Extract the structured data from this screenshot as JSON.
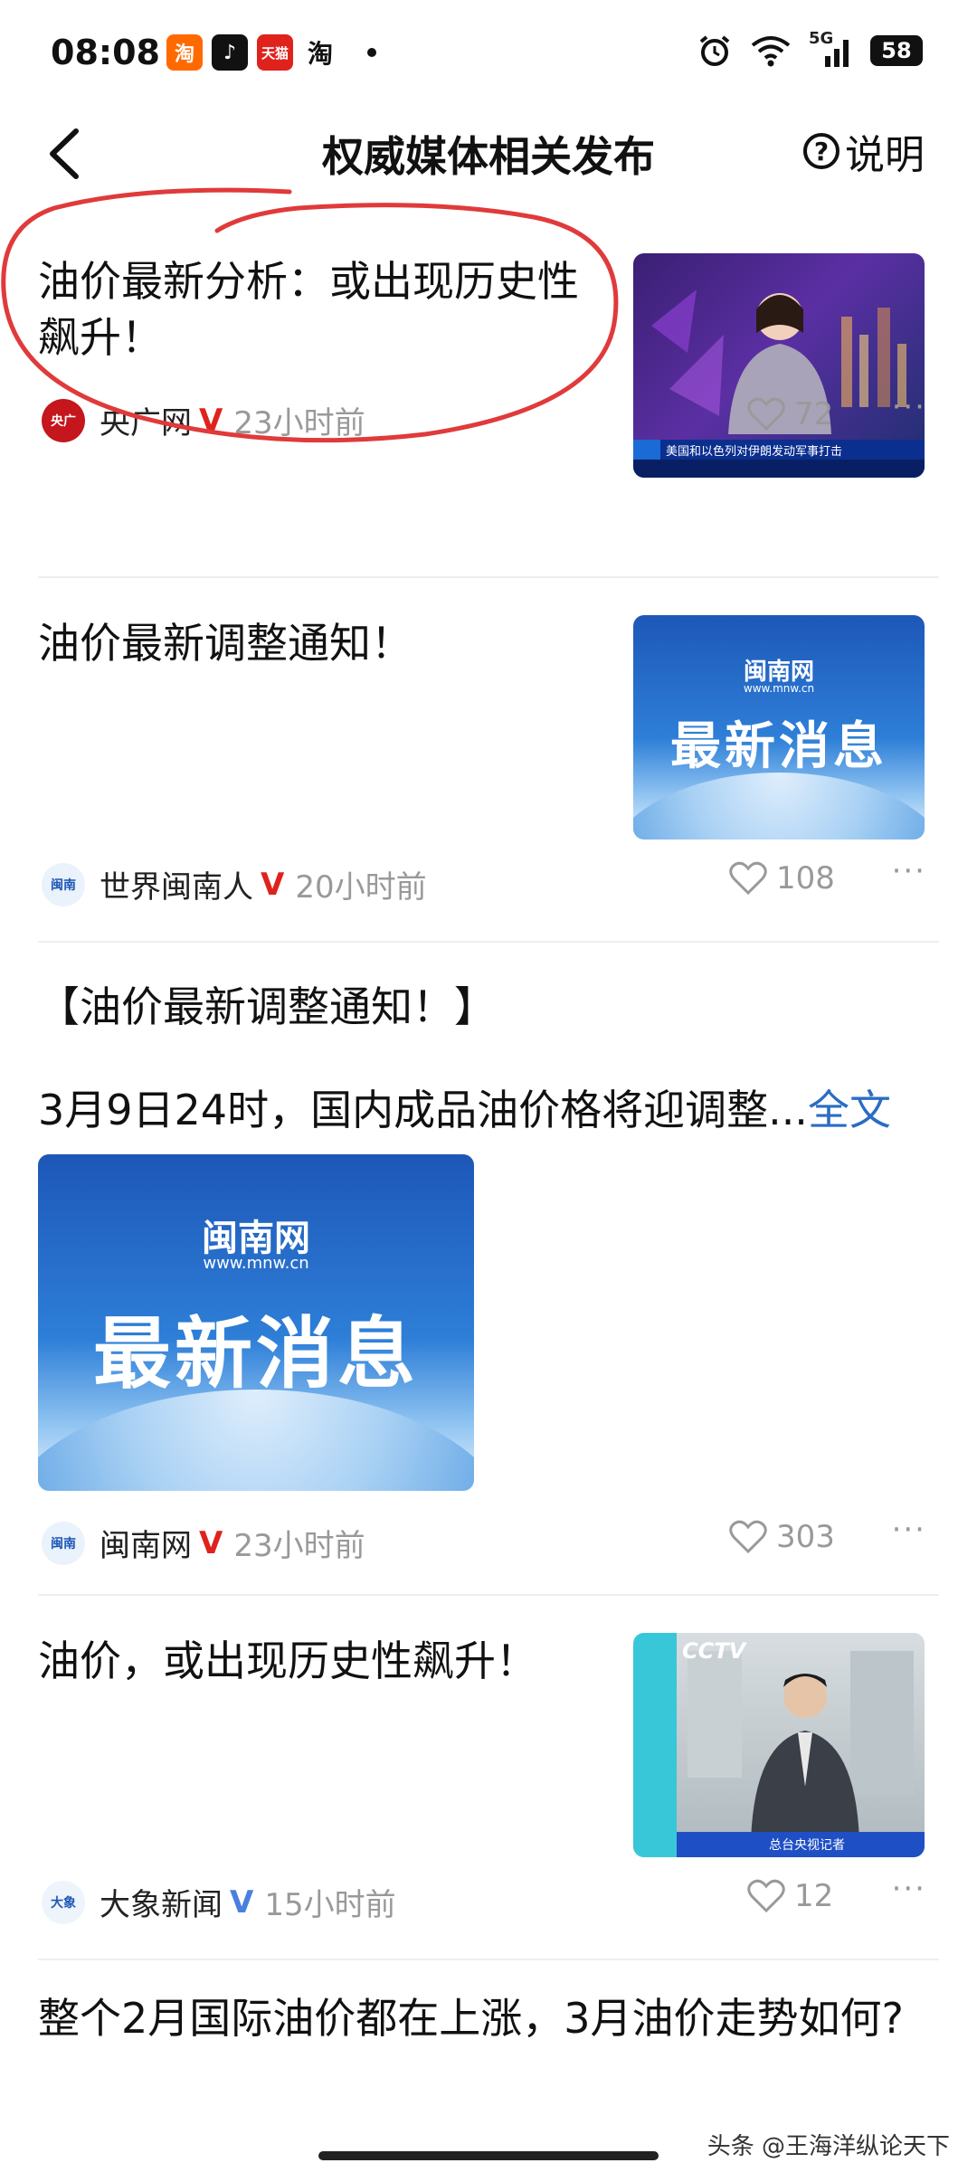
{
  "status_bar": {
    "time": "08:08",
    "apps": [
      {
        "name": "taobao-tejia-icon",
        "label": "淘",
        "color": "#ff6a00"
      },
      {
        "name": "douyin-icon",
        "label": "♪",
        "color": "#111111"
      },
      {
        "name": "tmall-icon",
        "label": "天猫",
        "color": "#e0221d"
      },
      {
        "name": "taobao-icon",
        "label": "淘",
        "color": "#ffffff"
      }
    ],
    "network": "5G",
    "battery": "58"
  },
  "nav": {
    "title": "权威媒体相关发布",
    "help_label": "说明"
  },
  "feed": [
    {
      "title": "油价最新分析：或出现历史性飙升！",
      "source": "央广网",
      "verified": "V",
      "time": "23小时前",
      "likes": "72",
      "thumb_caption": "美国和以色列对伊朗发动军事打击"
    },
    {
      "title": "油价最新调整通知！",
      "source": "世界闽南人",
      "verified": "V",
      "time": "20小时前",
      "likes": "108",
      "thumb_brand": "闽南网",
      "thumb_url": "www.mnw.cn",
      "thumb_text": "最新消息"
    },
    {
      "title": "【油价最新调整通知！】",
      "excerpt": "3月9日24时，国内成品油价格将迎调整...",
      "fulltext": "全文",
      "source": "闽南网",
      "verified": "V",
      "time": "23小时前",
      "likes": "303",
      "thumb_brand": "闽南网",
      "thumb_url": "www.mnw.cn",
      "thumb_text": "最新消息"
    },
    {
      "title": "油价，或出现历史性飙升！",
      "source": "大象新闻",
      "verified": "V",
      "time": "15小时前",
      "likes": "12",
      "thumb_logo": "CCTV",
      "thumb_caption": "总台央视记者"
    },
    {
      "title": "整个2月国际油价都在上涨，3月油价走势如何?"
    }
  ],
  "watermark": "头条 @王海洋纵论天下",
  "colors": {
    "accent_blue": "#2b6cc4",
    "verified_red": "#e0221d",
    "verified_blue": "#4a7fe0",
    "annotation_red": "#e03a3a"
  }
}
